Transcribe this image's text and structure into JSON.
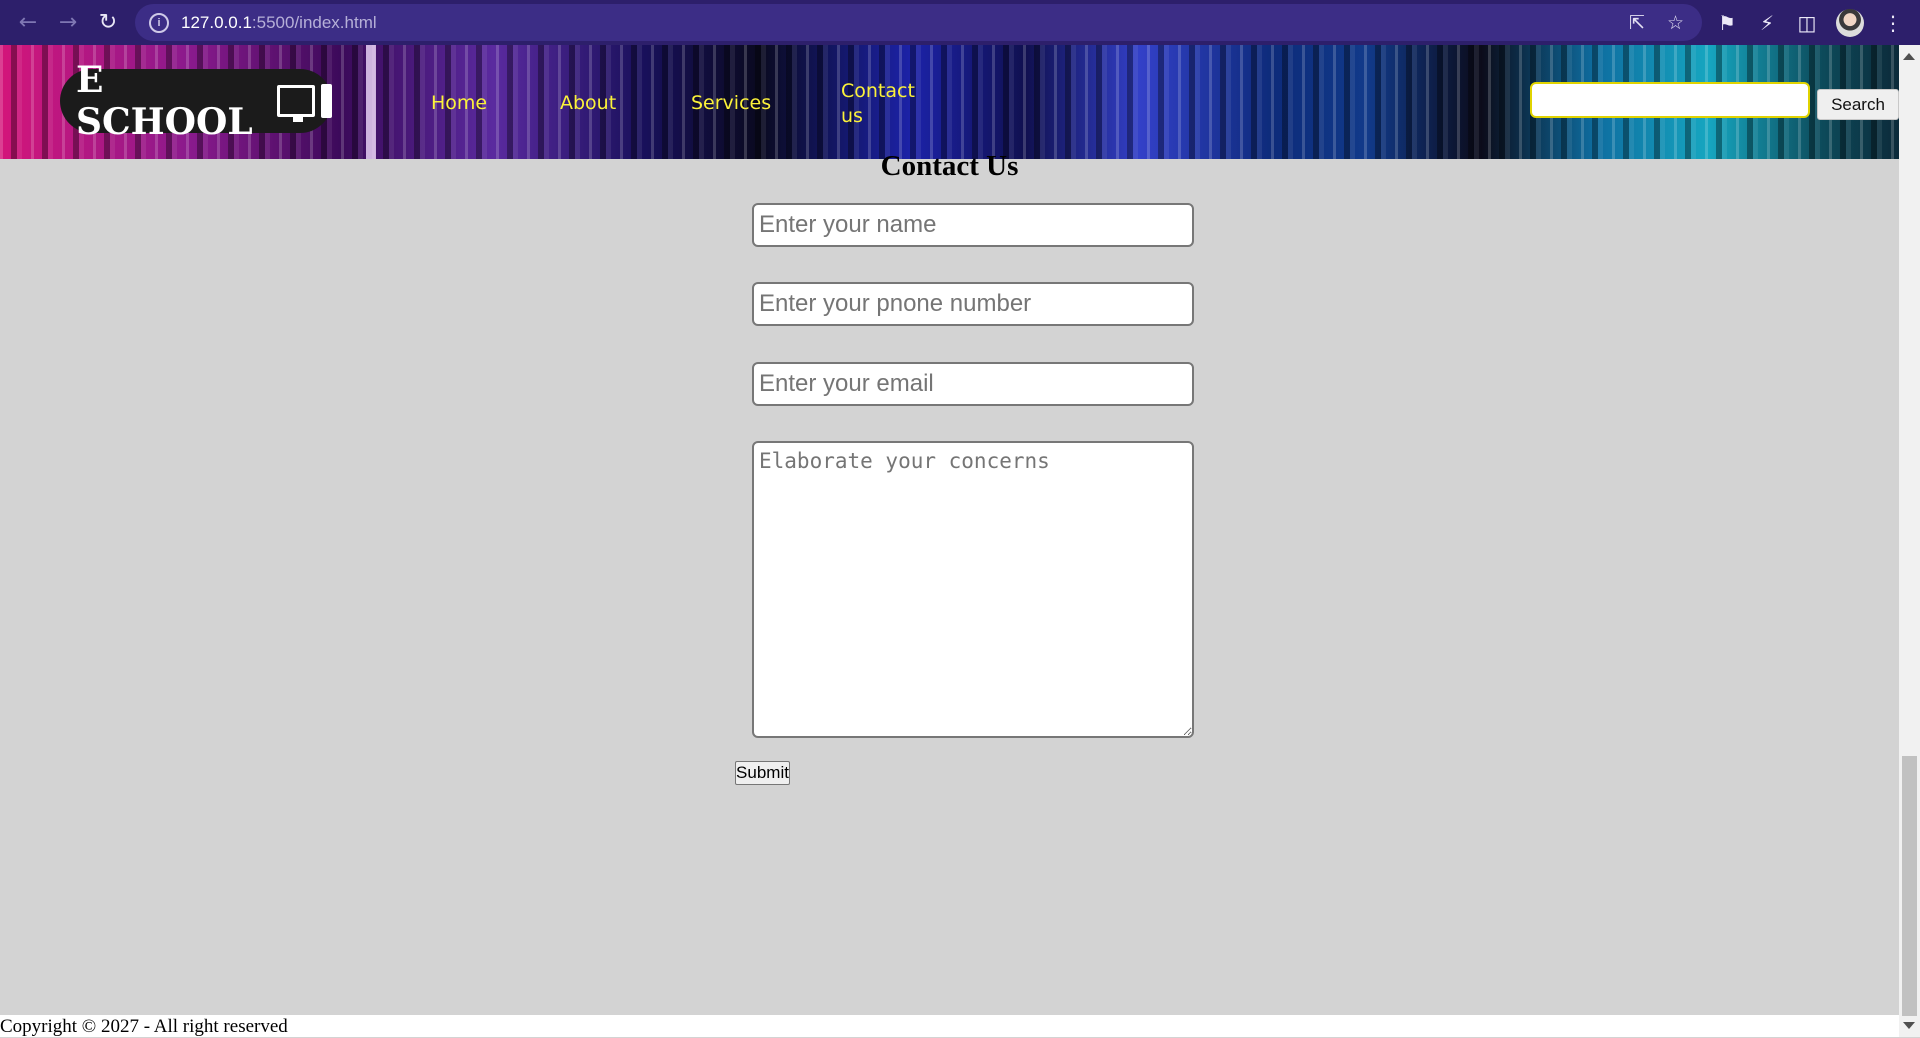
{
  "browser": {
    "url_host": "127.0.0.1",
    "url_path": ":5500/index.html",
    "icons": {
      "back": "arrow-left-icon",
      "forward": "arrow-right-icon",
      "reload": "reload-icon",
      "site_info": "info-icon",
      "share": "share-icon",
      "bookmark": "star-icon",
      "extensions": "puzzle-icon",
      "extension2": "lightning-circle-icon",
      "sidepanel": "side-panel-icon",
      "profile": "avatar-icon",
      "menu": "kebab-menu-icon"
    }
  },
  "header": {
    "logo_text": "E SCHOOL",
    "logo_icon": "monitor-phone-icon",
    "nav": [
      {
        "label": "Home"
      },
      {
        "label": "About"
      },
      {
        "label": "Services"
      },
      {
        "label": "Contact us"
      }
    ],
    "search_button": "Search",
    "search_value": ""
  },
  "contact": {
    "title": "Contact Us",
    "name_placeholder": "Enter your name",
    "phone_placeholder": "Enter your pnone number",
    "email_placeholder": "Enter your email",
    "concerns_placeholder": "Elaborate your concerns",
    "submit_label": "Submit"
  },
  "footer": {
    "copyright": "Copyright © 2027 - All right reserved"
  },
  "colors": {
    "chrome_bg": "#2d1f6b",
    "omnibox_bg": "#3c2d86",
    "page_bg": "#d3d3d3",
    "nav_link": "#fbf23a",
    "search_border": "#e0d300"
  }
}
